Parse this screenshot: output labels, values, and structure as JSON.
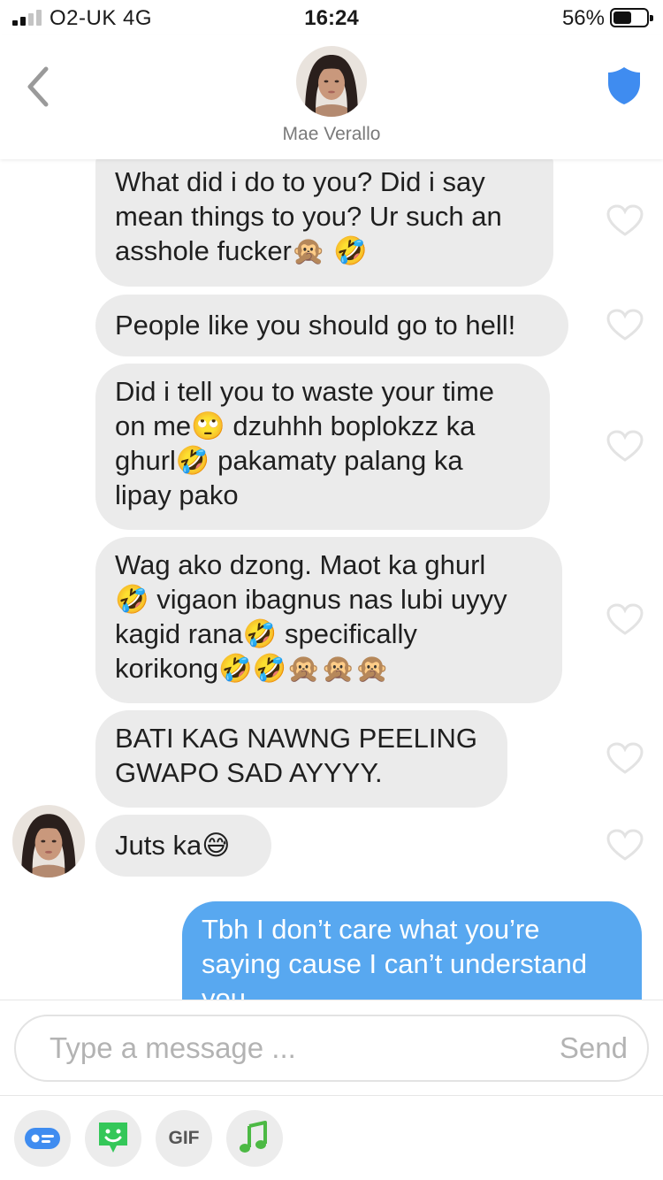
{
  "status_bar": {
    "carrier": "O2-UK  4G",
    "time": "16:24",
    "battery": "56%",
    "battery_level": 0.56
  },
  "header": {
    "contact_name": "Mae Verallo",
    "back_icon": "chevron-left-icon",
    "safety_icon": "shield-icon"
  },
  "messages": [
    {
      "lines": [
        "What did i do to you? Did i say",
        "mean things to you? Ur such an",
        "asshole fucker🙊 🤣"
      ]
    },
    {
      "lines": [
        "People like you should go to hell!"
      ]
    },
    {
      "lines": [
        "Did i tell you to waste your time",
        "on me🙄  dzuhhh boplokzz  ka",
        "ghurl🤣 pakamaty palang ka",
        "lipay pako"
      ]
    },
    {
      "lines": [
        "Wag ako dzong. Maot ka ghurl",
        "🤣 vigaon ibagnus nas lubi uyyy",
        "kagid rana🤣 specifically",
        "korikong🤣🤣🙊🙊🙊"
      ]
    },
    {
      "lines": [
        "BATI KAG NAWNG PEELING",
        "GWAPO SAD AYYYY."
      ]
    },
    {
      "lines": [
        "Juts ka😅"
      ]
    },
    {
      "lines": [
        "Tbh I don’t care what you’re",
        "saying cause I can’t understand",
        "you"
      ]
    }
  ],
  "composer": {
    "placeholder": "Type a message ...",
    "send_label": "Send"
  },
  "toolbar": {
    "gif_label": "GIF"
  },
  "colors": {
    "incoming_bubble": "#ebebeb",
    "outgoing_bubble": "#58a8f0",
    "shield": "#3f8cf0",
    "sticker": "#34c759",
    "contact_card": "#3f8cf0"
  }
}
